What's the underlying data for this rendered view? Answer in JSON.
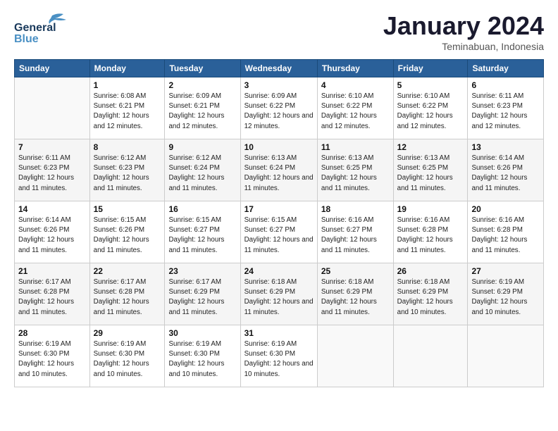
{
  "header": {
    "title": "January 2024",
    "location": "Teminabuan, Indonesia"
  },
  "days_of_week": [
    "Sunday",
    "Monday",
    "Tuesday",
    "Wednesday",
    "Thursday",
    "Friday",
    "Saturday"
  ],
  "weeks": [
    [
      {
        "day": "",
        "sunrise": "",
        "sunset": "",
        "daylight": ""
      },
      {
        "day": "1",
        "sunrise": "6:08 AM",
        "sunset": "6:21 PM",
        "daylight": "12 hours and 12 minutes."
      },
      {
        "day": "2",
        "sunrise": "6:09 AM",
        "sunset": "6:21 PM",
        "daylight": "12 hours and 12 minutes."
      },
      {
        "day": "3",
        "sunrise": "6:09 AM",
        "sunset": "6:22 PM",
        "daylight": "12 hours and 12 minutes."
      },
      {
        "day": "4",
        "sunrise": "6:10 AM",
        "sunset": "6:22 PM",
        "daylight": "12 hours and 12 minutes."
      },
      {
        "day": "5",
        "sunrise": "6:10 AM",
        "sunset": "6:22 PM",
        "daylight": "12 hours and 12 minutes."
      },
      {
        "day": "6",
        "sunrise": "6:11 AM",
        "sunset": "6:23 PM",
        "daylight": "12 hours and 12 minutes."
      }
    ],
    [
      {
        "day": "7",
        "sunrise": "6:11 AM",
        "sunset": "6:23 PM",
        "daylight": "12 hours and 11 minutes."
      },
      {
        "day": "8",
        "sunrise": "6:12 AM",
        "sunset": "6:23 PM",
        "daylight": "12 hours and 11 minutes."
      },
      {
        "day": "9",
        "sunrise": "6:12 AM",
        "sunset": "6:24 PM",
        "daylight": "12 hours and 11 minutes."
      },
      {
        "day": "10",
        "sunrise": "6:13 AM",
        "sunset": "6:24 PM",
        "daylight": "12 hours and 11 minutes."
      },
      {
        "day": "11",
        "sunrise": "6:13 AM",
        "sunset": "6:25 PM",
        "daylight": "12 hours and 11 minutes."
      },
      {
        "day": "12",
        "sunrise": "6:13 AM",
        "sunset": "6:25 PM",
        "daylight": "12 hours and 11 minutes."
      },
      {
        "day": "13",
        "sunrise": "6:14 AM",
        "sunset": "6:26 PM",
        "daylight": "12 hours and 11 minutes."
      }
    ],
    [
      {
        "day": "14",
        "sunrise": "6:14 AM",
        "sunset": "6:26 PM",
        "daylight": "12 hours and 11 minutes."
      },
      {
        "day": "15",
        "sunrise": "6:15 AM",
        "sunset": "6:26 PM",
        "daylight": "12 hours and 11 minutes."
      },
      {
        "day": "16",
        "sunrise": "6:15 AM",
        "sunset": "6:27 PM",
        "daylight": "12 hours and 11 minutes."
      },
      {
        "day": "17",
        "sunrise": "6:15 AM",
        "sunset": "6:27 PM",
        "daylight": "12 hours and 11 minutes."
      },
      {
        "day": "18",
        "sunrise": "6:16 AM",
        "sunset": "6:27 PM",
        "daylight": "12 hours and 11 minutes."
      },
      {
        "day": "19",
        "sunrise": "6:16 AM",
        "sunset": "6:28 PM",
        "daylight": "12 hours and 11 minutes."
      },
      {
        "day": "20",
        "sunrise": "6:16 AM",
        "sunset": "6:28 PM",
        "daylight": "12 hours and 11 minutes."
      }
    ],
    [
      {
        "day": "21",
        "sunrise": "6:17 AM",
        "sunset": "6:28 PM",
        "daylight": "12 hours and 11 minutes."
      },
      {
        "day": "22",
        "sunrise": "6:17 AM",
        "sunset": "6:28 PM",
        "daylight": "12 hours and 11 minutes."
      },
      {
        "day": "23",
        "sunrise": "6:17 AM",
        "sunset": "6:29 PM",
        "daylight": "12 hours and 11 minutes."
      },
      {
        "day": "24",
        "sunrise": "6:18 AM",
        "sunset": "6:29 PM",
        "daylight": "12 hours and 11 minutes."
      },
      {
        "day": "25",
        "sunrise": "6:18 AM",
        "sunset": "6:29 PM",
        "daylight": "12 hours and 11 minutes."
      },
      {
        "day": "26",
        "sunrise": "6:18 AM",
        "sunset": "6:29 PM",
        "daylight": "12 hours and 10 minutes."
      },
      {
        "day": "27",
        "sunrise": "6:19 AM",
        "sunset": "6:29 PM",
        "daylight": "12 hours and 10 minutes."
      }
    ],
    [
      {
        "day": "28",
        "sunrise": "6:19 AM",
        "sunset": "6:30 PM",
        "daylight": "12 hours and 10 minutes."
      },
      {
        "day": "29",
        "sunrise": "6:19 AM",
        "sunset": "6:30 PM",
        "daylight": "12 hours and 10 minutes."
      },
      {
        "day": "30",
        "sunrise": "6:19 AM",
        "sunset": "6:30 PM",
        "daylight": "12 hours and 10 minutes."
      },
      {
        "day": "31",
        "sunrise": "6:19 AM",
        "sunset": "6:30 PM",
        "daylight": "12 hours and 10 minutes."
      },
      {
        "day": "",
        "sunrise": "",
        "sunset": "",
        "daylight": ""
      },
      {
        "day": "",
        "sunrise": "",
        "sunset": "",
        "daylight": ""
      },
      {
        "day": "",
        "sunrise": "",
        "sunset": "",
        "daylight": ""
      }
    ]
  ]
}
